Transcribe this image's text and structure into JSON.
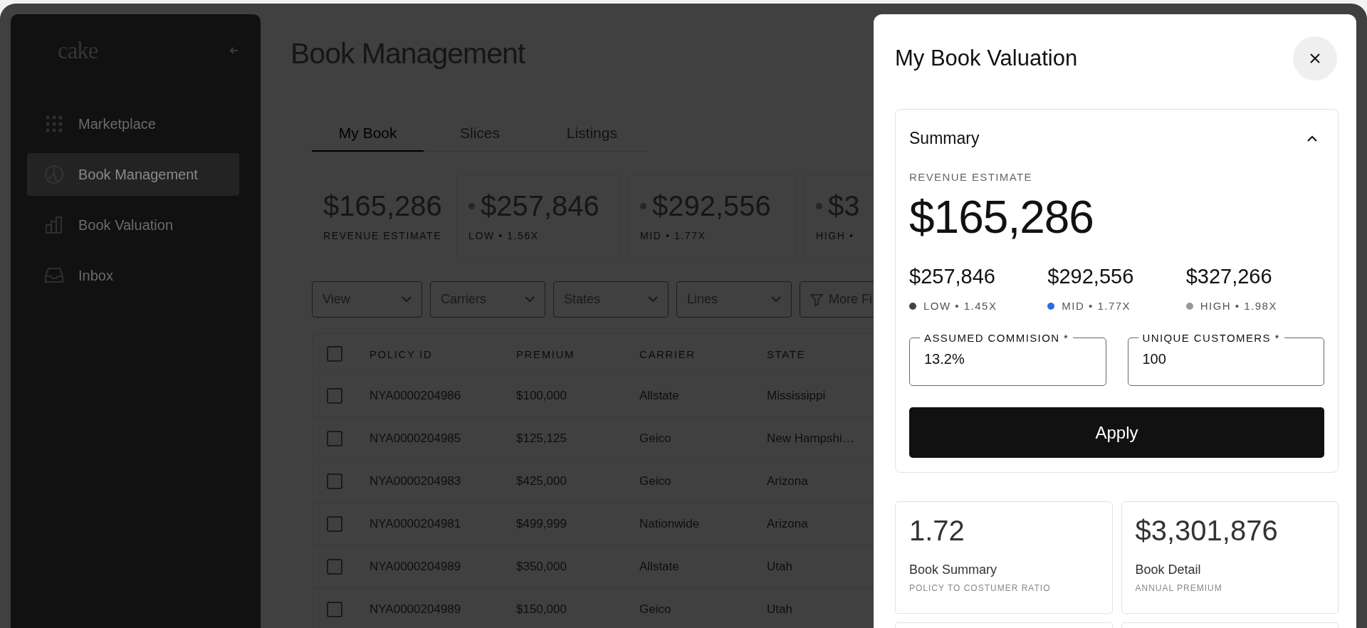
{
  "sidebar": {
    "logo": "cake",
    "items": [
      {
        "label": "Marketplace",
        "kind": "grid",
        "selected": false
      },
      {
        "label": "Book Management",
        "kind": "pie",
        "selected": true
      },
      {
        "label": "Book Valuation",
        "kind": "bars",
        "selected": false
      },
      {
        "label": "Inbox",
        "kind": "inbox",
        "selected": false
      }
    ]
  },
  "page": {
    "title": "Book Management",
    "tabs": [
      {
        "label": "My Book",
        "selected": true
      },
      {
        "label": "Slices",
        "selected": false
      },
      {
        "label": "Listings",
        "selected": false
      }
    ],
    "stats": [
      {
        "kind": "plain",
        "value": "$165,286",
        "label": "REVENUE ESTIMATE"
      },
      {
        "kind": "tier",
        "value": "$257,846",
        "label": "LOW • 1.56X"
      },
      {
        "kind": "tier",
        "value": "$292,556",
        "label": "MID • 1.77X"
      },
      {
        "kind": "tier",
        "value": "$3",
        "label": "HIGH •"
      }
    ],
    "filters": [
      {
        "kind": "dropdown",
        "label": "View"
      },
      {
        "kind": "dropdown",
        "label": "Carriers"
      },
      {
        "kind": "dropdown",
        "label": "States"
      },
      {
        "kind": "dropdown",
        "label": "Lines"
      },
      {
        "kind": "filter",
        "label": "More Fi"
      }
    ],
    "table": {
      "all_checked": false,
      "columns": [
        "POLICY ID",
        "PREMIUM",
        "CARRIER",
        "STATE"
      ],
      "rows": [
        {
          "checked": false,
          "cells": [
            "NYA0000204986",
            "$100,000",
            "Allstate",
            "Mississippi"
          ]
        },
        {
          "checked": false,
          "cells": [
            "NYA0000204985",
            "$125,125",
            "Geico",
            "New Hampshi…"
          ]
        },
        {
          "checked": false,
          "cells": [
            "NYA0000204983",
            "$425,000",
            "Geico",
            "Arizona"
          ]
        },
        {
          "checked": false,
          "cells": [
            "NYA0000204981",
            "$499,999",
            "Nationwide",
            "Arizona"
          ]
        },
        {
          "checked": false,
          "cells": [
            "NYA0000204989",
            "$350,000",
            "Allstate",
            "Utah"
          ]
        },
        {
          "checked": false,
          "cells": [
            "NYA0000204989",
            "$150,000",
            "Geico",
            "Utah"
          ]
        }
      ]
    }
  },
  "panel": {
    "title": "My Book Valuation",
    "summary": {
      "title": "Summary",
      "expanded": true,
      "revenue_label": "REVENUE ESTIMATE",
      "revenue_value": "$165,286",
      "tiers": [
        {
          "value": "$257,846",
          "label": "LOW • 1.45X",
          "color": "#444444"
        },
        {
          "value": "$292,556",
          "label": "MID • 1.77X",
          "color": "#2f6be8"
        },
        {
          "value": "$327,266",
          "label": "HIGH • 1.98X",
          "color": "#999999"
        }
      ],
      "fields": [
        {
          "label": "ASSUMED COMMISION *",
          "value": "13.2%"
        },
        {
          "label": "UNIQUE CUSTOMERS *",
          "value": "100"
        }
      ],
      "apply": "Apply"
    },
    "metrics": [
      {
        "value": "1.72",
        "title": "Book Summary",
        "subtitle": "POLICY TO COSTUMER RATIO"
      },
      {
        "value": "$3,301,876",
        "title": "Book Detail",
        "subtitle": "ANNUAL PREMIUM"
      }
    ]
  }
}
